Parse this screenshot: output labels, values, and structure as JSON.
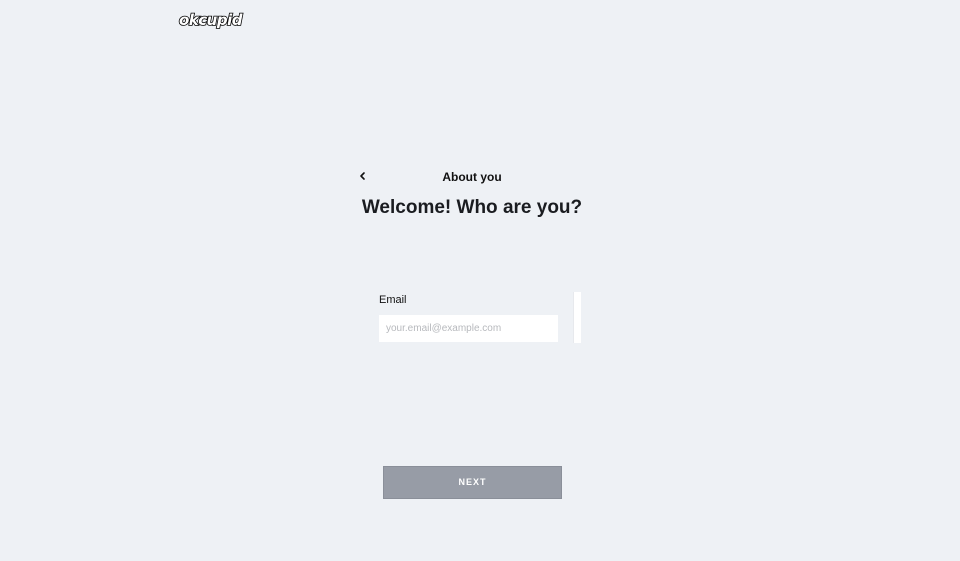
{
  "header": {
    "logo_text": "okcupid"
  },
  "step": {
    "title": "About you",
    "back_icon": "chevron-left-icon"
  },
  "main": {
    "heading": "Welcome! Who are you?"
  },
  "form": {
    "email_label": "Email",
    "email_placeholder": "your.email@example.com",
    "email_value": ""
  },
  "actions": {
    "next_label": "NEXT"
  },
  "colors": {
    "background": "#eef1f5",
    "input_background": "#ffffff",
    "button_disabled": "#979ca6",
    "text": "#111111"
  }
}
